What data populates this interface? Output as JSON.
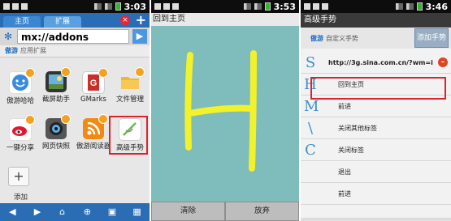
{
  "panel1": {
    "status_time": "3:03",
    "tabs": [
      "主页",
      "扩展"
    ],
    "url": "mx://addons",
    "section_brand": "傲游",
    "section_label": "应用扩展",
    "apps": [
      {
        "label": "傲游哈哈"
      },
      {
        "label": "截屏助手"
      },
      {
        "label": "GMarks"
      },
      {
        "label": "文件管理"
      },
      {
        "label": "一键分享"
      },
      {
        "label": "网页快照"
      },
      {
        "label": "傲游阅读器"
      },
      {
        "label": "高级手势"
      }
    ],
    "add_label": "添加"
  },
  "panel2": {
    "status_time": "3:53",
    "title": "高级手势",
    "header_text": "回到主页",
    "gesture_letter": "H",
    "buttons": [
      "清除",
      "放弃"
    ],
    "gesture_color": "#f2f22a"
  },
  "panel3": {
    "status_time": "3:46",
    "title": "高级手势",
    "header_brand": "傲游",
    "header_label": "自定义手势",
    "add_button": "添加手势",
    "gestures": [
      {
        "glyph": "S",
        "text": "http://3g.sina.com.cn/?wm=i"
      },
      {
        "glyph": "H",
        "text": "回到主页"
      },
      {
        "glyph": "M",
        "text": "前进"
      },
      {
        "glyph": "\\",
        "text": "关闭其他标签"
      },
      {
        "glyph": "C",
        "text": "关闭标签"
      },
      {
        "glyph": "",
        "text": "退出"
      },
      {
        "glyph": "",
        "text": "前进"
      }
    ]
  }
}
